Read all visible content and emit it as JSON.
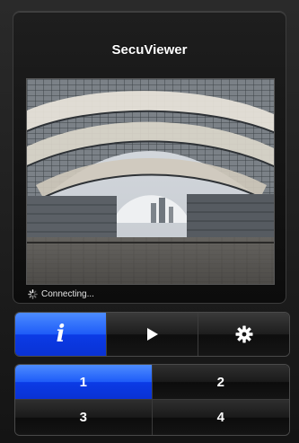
{
  "app": {
    "title": "SecuViewer"
  },
  "feed": {
    "status_text": "Connecting..."
  },
  "toolbar": {
    "items": [
      {
        "icon": "info-icon",
        "glyph": "i",
        "active": true
      },
      {
        "icon": "play-icon",
        "active": false
      },
      {
        "icon": "gear-icon",
        "active": false
      }
    ]
  },
  "channels": {
    "items": [
      {
        "label": "1",
        "active": true
      },
      {
        "label": "2",
        "active": false
      },
      {
        "label": "3",
        "active": false
      },
      {
        "label": "4",
        "active": false
      }
    ]
  },
  "colors": {
    "accent": "#1e5cf8",
    "background": "#1c1c1c",
    "text": "#ffffff"
  }
}
